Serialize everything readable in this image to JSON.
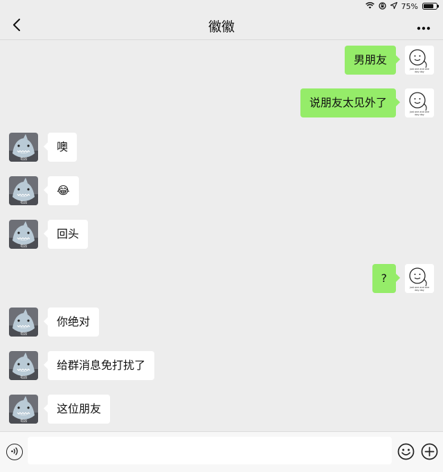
{
  "status_bar": {
    "battery_text": "75%",
    "battery_level": 0.75
  },
  "header": {
    "title": "徽徽",
    "back_icon": "chevron-left-icon",
    "more_icon": "ellipsis-icon"
  },
  "messages": [
    {
      "side": "right",
      "text": "男朋友"
    },
    {
      "side": "right",
      "text": "说朋友太见外了"
    },
    {
      "side": "left",
      "text": "噢"
    },
    {
      "side": "left",
      "text": "😂"
    },
    {
      "side": "left",
      "text": "回头"
    },
    {
      "side": "right",
      "text": "?"
    },
    {
      "side": "left",
      "text": "你绝对"
    },
    {
      "side": "left",
      "text": "给群消息免打扰了"
    },
    {
      "side": "left",
      "text": "这位朋友"
    }
  ],
  "avatars": {
    "self_caption": "just one and one day day",
    "friend_caption": "毛凶"
  },
  "input_bar": {
    "placeholder": "",
    "voice_icon": "voice-icon",
    "emoji_icon": "emoji-icon",
    "plus_icon": "plus-icon"
  }
}
